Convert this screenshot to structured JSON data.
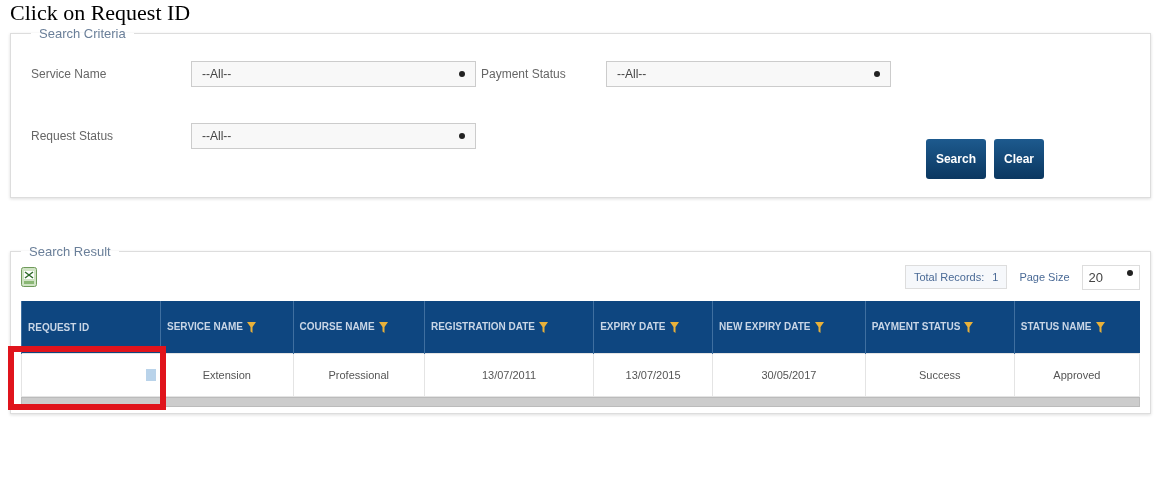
{
  "heading": "Click on Request ID",
  "criteria": {
    "legend": "Search Criteria",
    "fields": [
      {
        "label": "Service Name",
        "value": "--All--"
      },
      {
        "label": "Payment Status",
        "value": "--All--"
      },
      {
        "label": "Request Status",
        "value": "--All--"
      }
    ],
    "buttons": [
      "Search",
      "Clear"
    ]
  },
  "result": {
    "legend": "Search Result",
    "total_label": "Total Records:",
    "total": "1",
    "page_size_label": "Page Size",
    "page_size": "20",
    "table": {
      "columns": [
        {
          "label": "REQUEST ID",
          "filter": false
        },
        {
          "label": "SERVICE NAME",
          "filter": true
        },
        {
          "label": "COURSE NAME",
          "filter": true
        },
        {
          "label": "REGISTRATION DATE",
          "filter": true
        },
        {
          "label": "EXPIRY DATE",
          "filter": true
        },
        {
          "label": "NEW EXPIRY DATE",
          "filter": true
        },
        {
          "label": "PAYMENT STATUS",
          "filter": true
        },
        {
          "label": "STATUS NAME",
          "filter": true
        }
      ],
      "rows": [
        {
          "highlighted": true,
          "cells": [
            "",
            "Extension",
            "Professional",
            "13/07/2011",
            "13/07/2015",
            "30/05/2017",
            "Success",
            "Approved"
          ]
        }
      ]
    }
  }
}
